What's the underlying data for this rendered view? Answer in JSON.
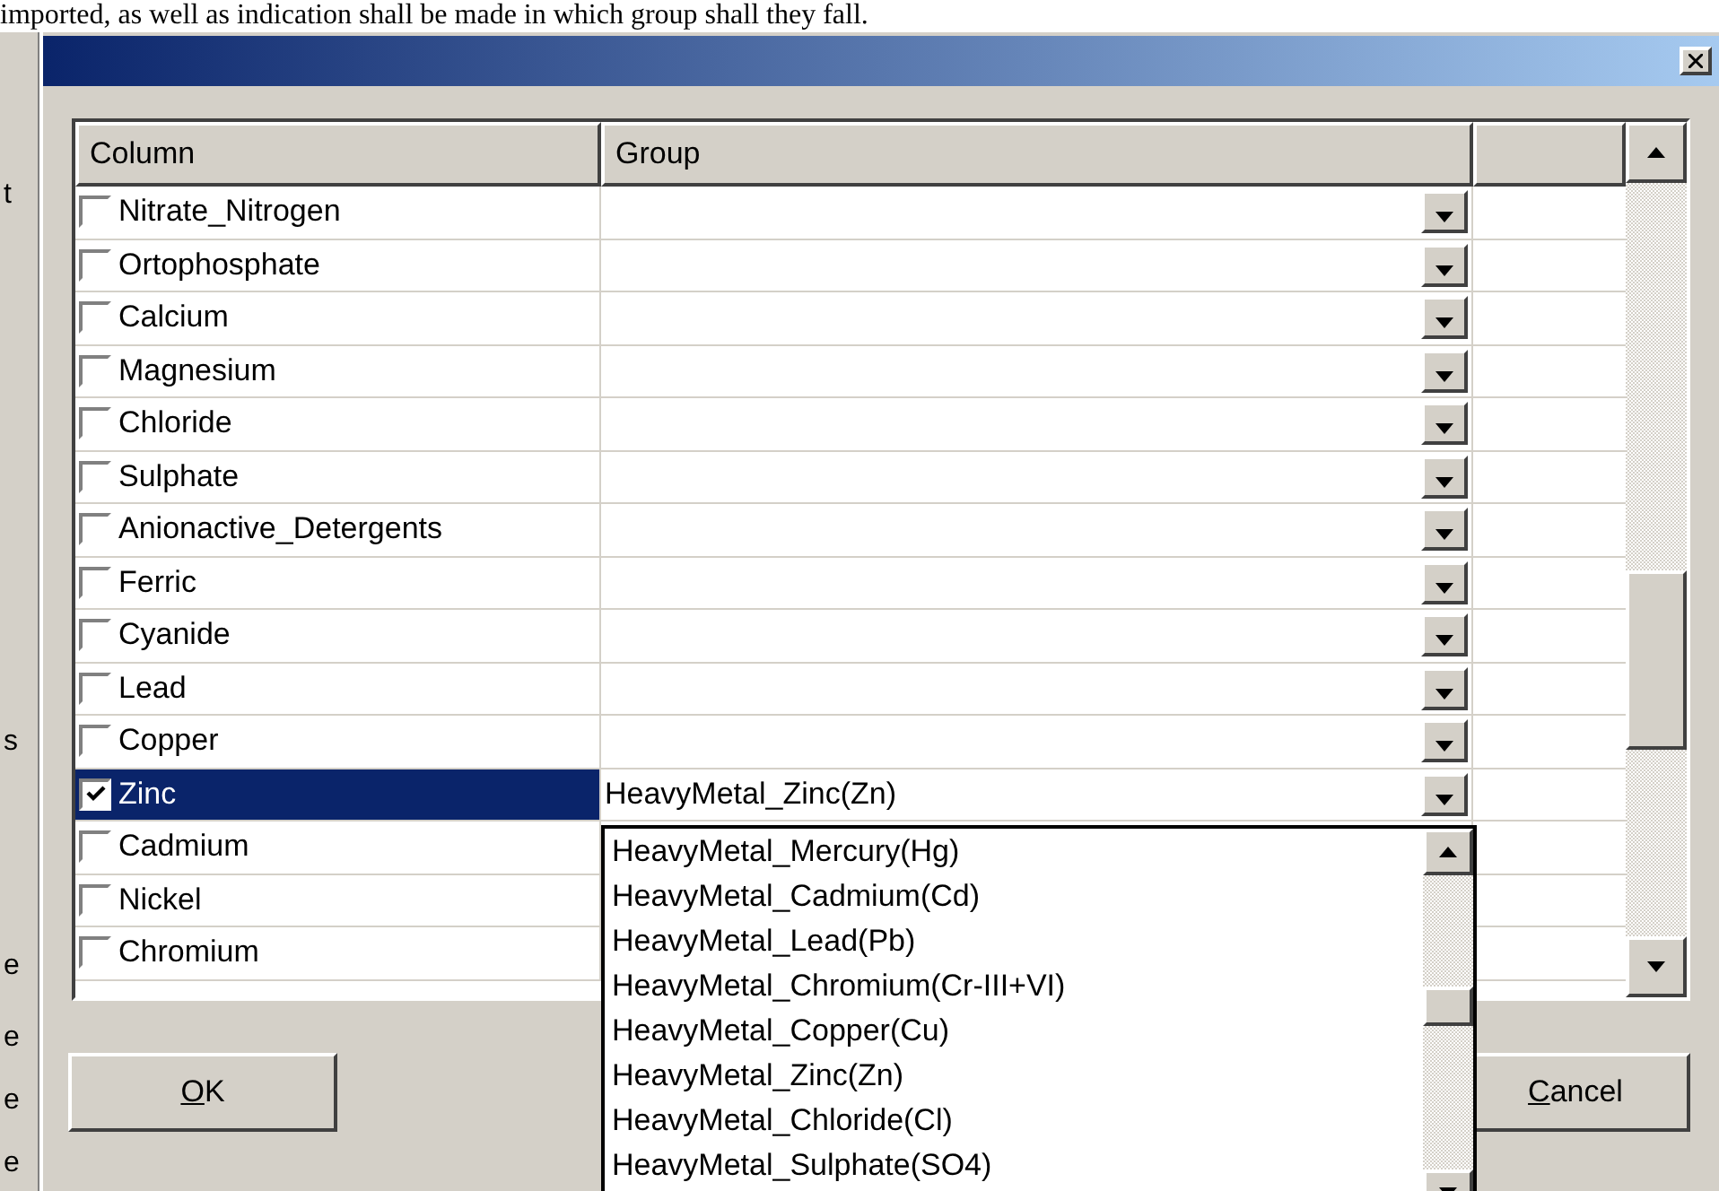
{
  "document_text": "imported, as well as indication shall be made in which group shall they fall.",
  "background_fragments": [
    {
      "text": "t"
    },
    {
      "text": "s"
    },
    {
      "text": "e"
    },
    {
      "text": "e"
    },
    {
      "text": "e"
    },
    {
      "text": "e"
    }
  ],
  "dialog": {
    "columns": [
      "Column",
      "Group"
    ],
    "rows": [
      {
        "name": "Nitrate_Nitrogen",
        "checked": false,
        "selected": false
      },
      {
        "name": "Ortophosphate",
        "checked": false,
        "selected": false
      },
      {
        "name": "Calcium",
        "checked": false,
        "selected": false
      },
      {
        "name": "Magnesium",
        "checked": false,
        "selected": false
      },
      {
        "name": "Chloride",
        "checked": false,
        "selected": false
      },
      {
        "name": "Sulphate",
        "checked": false,
        "selected": false
      },
      {
        "name": "Anionactive_Detergents",
        "checked": false,
        "selected": false
      },
      {
        "name": "Ferric",
        "checked": false,
        "selected": false
      },
      {
        "name": "Cyanide",
        "checked": false,
        "selected": false
      },
      {
        "name": "Lead",
        "checked": false,
        "selected": false
      },
      {
        "name": "Copper",
        "checked": false,
        "selected": false
      },
      {
        "name": "Zinc",
        "checked": true,
        "selected": true,
        "group": "HeavyMetal_Zinc(Zn)"
      },
      {
        "name": "Cadmium",
        "checked": false,
        "selected": false
      },
      {
        "name": "Nickel",
        "checked": false,
        "selected": false
      },
      {
        "name": "Chromium",
        "checked": false,
        "selected": false
      }
    ],
    "dropdown_items": [
      "HeavyMetal_Mercury(Hg)",
      "HeavyMetal_Cadmium(Cd)",
      "HeavyMetal_Lead(Pb)",
      "HeavyMetal_Chromium(Cr-III+VI)",
      "HeavyMetal_Copper(Cu)",
      "HeavyMetal_Zinc(Zn)",
      "HeavyMetal_Chloride(Cl)",
      "HeavyMetal_Sulphate(SO4)"
    ],
    "buttons": [
      {
        "accel": "O",
        "rest": "K"
      },
      {
        "accel": "C",
        "rest": "ancel"
      }
    ]
  }
}
